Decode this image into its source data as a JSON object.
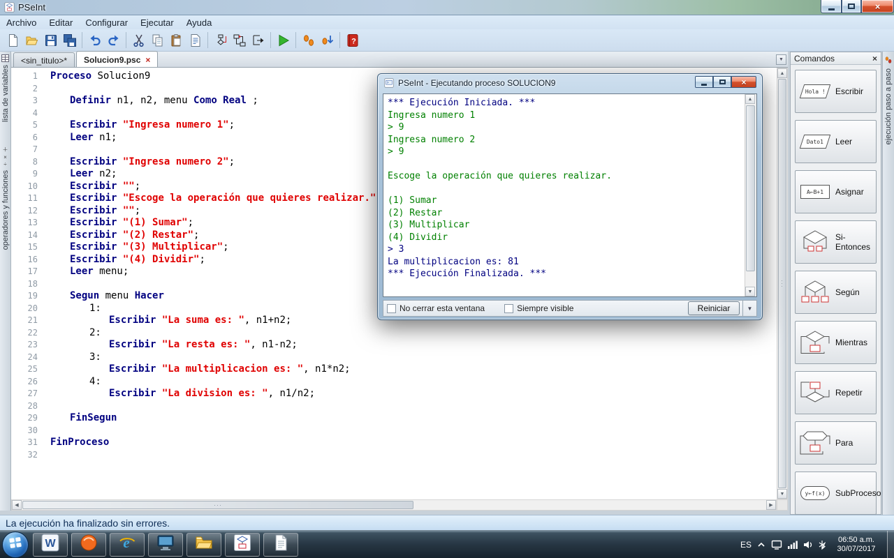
{
  "titlebar": {
    "title": "PSeInt",
    "controls": [
      "minimize",
      "maximize",
      "close"
    ]
  },
  "glyphs": {
    "close": "×",
    "up": "▲",
    "down": "▼",
    "left": "◀",
    "right": "▶",
    "grip": "···"
  },
  "menubar": {
    "items": [
      "Archivo",
      "Editar",
      "Configurar",
      "Ejecutar",
      "Ayuda"
    ]
  },
  "toolbar": {
    "items": [
      "new-file",
      "open-file",
      "save",
      "save-as",
      "sep",
      "undo",
      "redo",
      "sep",
      "cut",
      "copy",
      "paste",
      "find-replace",
      "sep",
      "syntax-check",
      "flowchart",
      "export",
      "sep",
      "run",
      "sep",
      "step-run",
      "run-to-line",
      "sep",
      "help"
    ]
  },
  "tabs": {
    "items": [
      {
        "label": "<sin_titulo>*",
        "active": false
      },
      {
        "label": "Solucion9.psc",
        "active": true
      }
    ]
  },
  "left_strip": {
    "sections": [
      {
        "label": "lista de variables"
      },
      {
        "label": "operadores y funciones"
      }
    ]
  },
  "right_strip": {
    "label": "ejecución paso a paso"
  },
  "editor": {
    "lines": [
      {
        "n": 1,
        "ind": 0,
        "seg": [
          [
            "kw",
            "Proceso"
          ],
          [
            "pl",
            " Solucion9"
          ]
        ]
      },
      {
        "n": 2,
        "ind": 0,
        "seg": []
      },
      {
        "n": 3,
        "ind": 1,
        "seg": [
          [
            "kw",
            "Definir"
          ],
          [
            "pl",
            " n1, n2, menu "
          ],
          [
            "kw",
            "Como Real"
          ],
          [
            "pl",
            " ;"
          ]
        ]
      },
      {
        "n": 4,
        "ind": 0,
        "seg": []
      },
      {
        "n": 5,
        "ind": 1,
        "seg": [
          [
            "kw",
            "Escribir"
          ],
          [
            "pl",
            " "
          ],
          [
            "st",
            "\"Ingresa numero 1\""
          ],
          [
            "pl",
            ";"
          ]
        ]
      },
      {
        "n": 6,
        "ind": 1,
        "seg": [
          [
            "kw",
            "Leer"
          ],
          [
            "pl",
            " n1;"
          ]
        ]
      },
      {
        "n": 7,
        "ind": 0,
        "seg": []
      },
      {
        "n": 8,
        "ind": 1,
        "seg": [
          [
            "kw",
            "Escribir"
          ],
          [
            "pl",
            " "
          ],
          [
            "st",
            "\"Ingresa numero 2\""
          ],
          [
            "pl",
            ";"
          ]
        ]
      },
      {
        "n": 9,
        "ind": 1,
        "seg": [
          [
            "kw",
            "Leer"
          ],
          [
            "pl",
            " n2;"
          ]
        ]
      },
      {
        "n": 10,
        "ind": 1,
        "seg": [
          [
            "kw",
            "Escribir"
          ],
          [
            "pl",
            " "
          ],
          [
            "st",
            "\"\""
          ],
          [
            "pl",
            ";"
          ]
        ]
      },
      {
        "n": 11,
        "ind": 1,
        "seg": [
          [
            "kw",
            "Escribir"
          ],
          [
            "pl",
            " "
          ],
          [
            "st",
            "\"Escoge la operación que quieres realizar.\""
          ],
          [
            "pl",
            ";"
          ]
        ]
      },
      {
        "n": 12,
        "ind": 1,
        "seg": [
          [
            "kw",
            "Escribir"
          ],
          [
            "pl",
            " "
          ],
          [
            "st",
            "\"\""
          ],
          [
            "pl",
            ";"
          ]
        ]
      },
      {
        "n": 13,
        "ind": 1,
        "seg": [
          [
            "kw",
            "Escribir"
          ],
          [
            "pl",
            " "
          ],
          [
            "st",
            "\"(1) Sumar\""
          ],
          [
            "pl",
            ";"
          ]
        ]
      },
      {
        "n": 14,
        "ind": 1,
        "seg": [
          [
            "kw",
            "Escribir"
          ],
          [
            "pl",
            " "
          ],
          [
            "st",
            "\"(2) Restar\""
          ],
          [
            "pl",
            ";"
          ]
        ]
      },
      {
        "n": 15,
        "ind": 1,
        "seg": [
          [
            "kw",
            "Escribir"
          ],
          [
            "pl",
            " "
          ],
          [
            "st",
            "\"(3) Multiplicar\""
          ],
          [
            "pl",
            ";"
          ]
        ]
      },
      {
        "n": 16,
        "ind": 1,
        "seg": [
          [
            "kw",
            "Escribir"
          ],
          [
            "pl",
            " "
          ],
          [
            "st",
            "\"(4) Dividir\""
          ],
          [
            "pl",
            ";"
          ]
        ]
      },
      {
        "n": 17,
        "ind": 1,
        "seg": [
          [
            "kw",
            "Leer"
          ],
          [
            "pl",
            " menu;"
          ]
        ]
      },
      {
        "n": 18,
        "ind": 0,
        "seg": []
      },
      {
        "n": 19,
        "ind": 1,
        "seg": [
          [
            "kw",
            "Segun"
          ],
          [
            "pl",
            " menu "
          ],
          [
            "kw",
            "Hacer"
          ]
        ]
      },
      {
        "n": 20,
        "ind": 2,
        "seg": [
          [
            "pl",
            "1:"
          ]
        ]
      },
      {
        "n": 21,
        "ind": 3,
        "seg": [
          [
            "kw",
            "Escribir"
          ],
          [
            "pl",
            " "
          ],
          [
            "st",
            "\"La suma es: \""
          ],
          [
            "pl",
            ", n1+n2;"
          ]
        ]
      },
      {
        "n": 22,
        "ind": 2,
        "seg": [
          [
            "pl",
            "2:"
          ]
        ]
      },
      {
        "n": 23,
        "ind": 3,
        "seg": [
          [
            "kw",
            "Escribir"
          ],
          [
            "pl",
            " "
          ],
          [
            "st",
            "\"La resta es: \""
          ],
          [
            "pl",
            ", n1-n2;"
          ]
        ]
      },
      {
        "n": 24,
        "ind": 2,
        "seg": [
          [
            "pl",
            "3:"
          ]
        ]
      },
      {
        "n": 25,
        "ind": 3,
        "seg": [
          [
            "kw",
            "Escribir"
          ],
          [
            "pl",
            " "
          ],
          [
            "st",
            "\"La multiplicacion es: \""
          ],
          [
            "pl",
            ", n1*n2;"
          ]
        ]
      },
      {
        "n": 26,
        "ind": 2,
        "seg": [
          [
            "pl",
            "4:"
          ]
        ]
      },
      {
        "n": 27,
        "ind": 3,
        "seg": [
          [
            "kw",
            "Escribir"
          ],
          [
            "pl",
            " "
          ],
          [
            "st",
            "\"La division es: \""
          ],
          [
            "pl",
            ", n1/n2;"
          ]
        ]
      },
      {
        "n": 28,
        "ind": 0,
        "seg": []
      },
      {
        "n": 29,
        "ind": 1,
        "seg": [
          [
            "kw",
            "FinSegun"
          ]
        ]
      },
      {
        "n": 30,
        "ind": 0,
        "seg": []
      },
      {
        "n": 31,
        "ind": 0,
        "seg": [
          [
            "kw",
            "FinProceso"
          ]
        ]
      },
      {
        "n": 32,
        "ind": 0,
        "seg": []
      }
    ]
  },
  "syntax_colors": {
    "keyword": "#000080",
    "string": "#e00000",
    "plain": "#000000"
  },
  "exec_window": {
    "title": "PSeInt - Ejecutando proceso SOLUCION9",
    "lines": [
      {
        "c": "sys",
        "t": "*** Ejecución Iniciada. ***"
      },
      {
        "c": "out",
        "t": "Ingresa numero 1"
      },
      {
        "c": "out",
        "t": "> 9"
      },
      {
        "c": "out",
        "t": "Ingresa numero 2"
      },
      {
        "c": "out",
        "t": "> 9"
      },
      {
        "c": "out",
        "t": ""
      },
      {
        "c": "out",
        "t": "Escoge la operación que quieres realizar."
      },
      {
        "c": "out",
        "t": ""
      },
      {
        "c": "out",
        "t": "(1) Sumar"
      },
      {
        "c": "out",
        "t": "(2) Restar"
      },
      {
        "c": "out",
        "t": "(3) Multiplicar"
      },
      {
        "c": "out",
        "t": "(4) Dividir"
      },
      {
        "c": "in",
        "t": "> 3"
      },
      {
        "c": "sys",
        "t": "La multiplicacion es: 81"
      },
      {
        "c": "sys",
        "t": "*** Ejecución Finalizada. ***"
      }
    ],
    "console_colors": {
      "output": "#008000",
      "input": "#000080",
      "system": "#000080"
    },
    "options": [
      {
        "label": "No cerrar esta ventana",
        "checked": false
      },
      {
        "label": "Siempre visible",
        "checked": false
      }
    ],
    "restart_button": "Reiniciar"
  },
  "commands_panel": {
    "title": "Comandos",
    "items": [
      {
        "label": "Escribir",
        "icon": "write-icon",
        "icon_text": "Hola !"
      },
      {
        "label": "Leer",
        "icon": "read-icon",
        "icon_text": "Dato1"
      },
      {
        "label": "Asignar",
        "icon": "assign-icon",
        "icon_text": "A←B+1"
      },
      {
        "label": "Si-Entonces",
        "icon": "if-icon"
      },
      {
        "label": "Según",
        "icon": "switch-icon"
      },
      {
        "label": "Mientras",
        "icon": "while-icon"
      },
      {
        "label": "Repetir",
        "icon": "repeat-icon"
      },
      {
        "label": "Para",
        "icon": "for-icon"
      },
      {
        "label": "SubProceso",
        "icon": "subprocess-icon",
        "icon_text": "y←f(x)"
      }
    ]
  },
  "statusbar": {
    "text": "La ejecución ha finalizado sin errores."
  },
  "taskbar": {
    "apps": [
      "word",
      "media-player",
      "internet-explorer",
      "system-app",
      "file-explorer",
      "pseint",
      "document-editor"
    ],
    "tray": {
      "language": "ES",
      "time": "06:50 a.m.",
      "date": "30/07/2017"
    }
  }
}
